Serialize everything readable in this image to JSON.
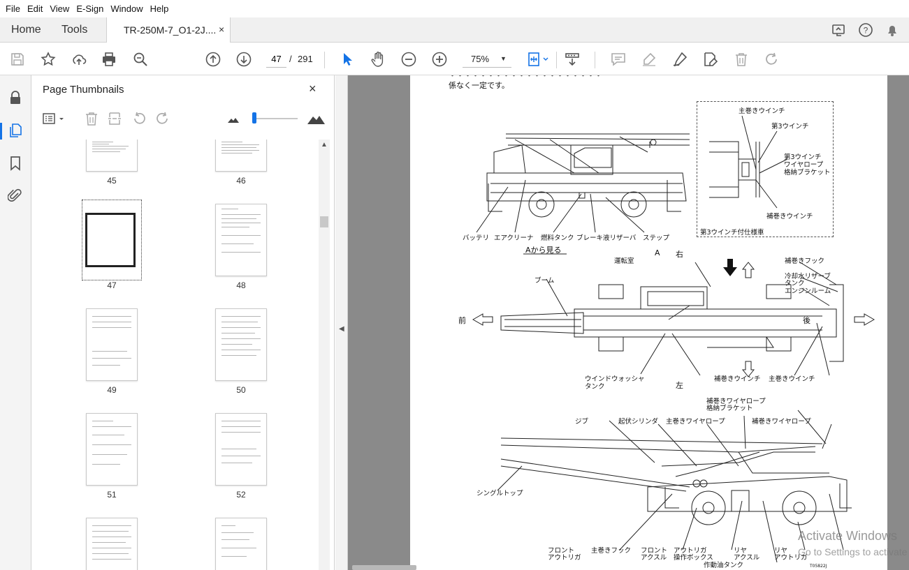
{
  "menu": [
    "File",
    "Edit",
    "View",
    "E-Sign",
    "Window",
    "Help"
  ],
  "tabs": {
    "home": "Home",
    "tools": "Tools",
    "document": "TR-250M-7_O1-2J....",
    "close": "×"
  },
  "toolbar": {
    "page_current": "47",
    "page_sep": "/",
    "page_total": "291",
    "zoom": "75%"
  },
  "thumbnails": {
    "title": "Page Thumbnails",
    "close": "×",
    "pages": [
      "45",
      "46",
      "47",
      "48",
      "49",
      "50",
      "51",
      "52"
    ],
    "selected": "47"
  },
  "document": {
    "lines": [
      "係なく一定です。"
    ],
    "labels": {
      "main_winch": "主巻きウインチ",
      "third_winch": "第3ウインチ",
      "third_bracket_1": "第3ウインチ",
      "third_bracket_2": "ワイヤロープ",
      "third_bracket_3": "格納ブラケット",
      "aux_winch": "補巻きウインチ",
      "third_spec": "第3ウインチ付仕様車",
      "battery": "バッテリ",
      "air_cleaner": "エアクリーナ",
      "fuel_tank": "燃料タンク",
      "brake_reservoir": "ブレーキ液リザーバ",
      "step": "ステップ",
      "view_from_a": "Aから見る",
      "a": "A",
      "right": "右",
      "cab": "運転室",
      "aux_hook": "補巻きフック",
      "coolant_1": "冷却水リザーブ",
      "coolant_2": "タンク",
      "engine_room": "エンジンルーム",
      "boom": "ブーム",
      "front": "前",
      "rear": "後",
      "left": "左",
      "washer_1": "ウインドウォッシャ",
      "washer_2": "タンク",
      "aux_winch_2": "補巻きウインチ",
      "main_winch_2": "主巻きウインチ",
      "aux_bracket_1": "補巻きワイヤロープ",
      "aux_bracket_2": "格納ブラケット",
      "jib": "ジブ",
      "derrick_cyl": "起伏シリンダ",
      "main_rope": "主巻きワイヤロープ",
      "aux_rope": "補巻きワイヤロープ",
      "single_top": "シングルトップ",
      "front_out_1": "フロント",
      "front_out_2": "アウトリガ",
      "main_hook": "主巻きフック",
      "front_axle_1": "フロント",
      "front_axle_2": "アクスル",
      "outrigger_box_1": "アウトリガ",
      "outrigger_box_2": "操作ボックス",
      "rear_axle_1": "リヤ",
      "rear_axle_2": "アクスル",
      "rear_out_1": "リヤ",
      "rear_out_2": "アウトリガ",
      "hyd_tank": "作動油タンク",
      "fig_id": "T05822J"
    }
  },
  "watermark": {
    "line1": "Activate Windows",
    "line2": "Go to Settings to activate"
  }
}
